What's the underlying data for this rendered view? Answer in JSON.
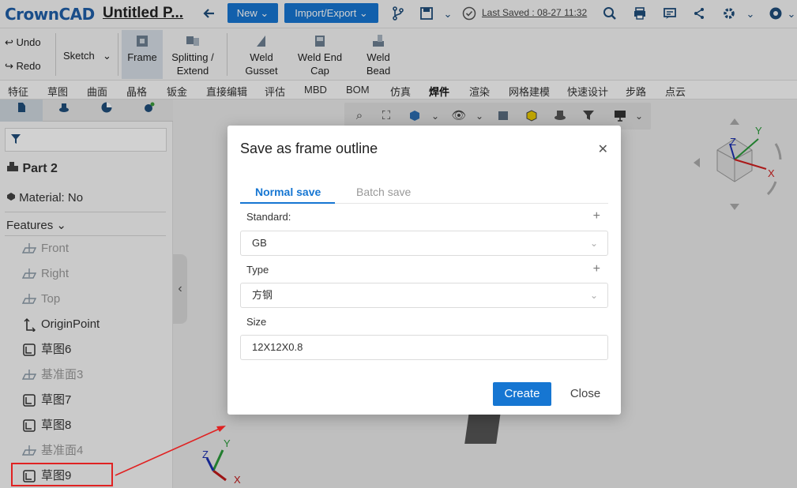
{
  "app": {
    "logo": "CrownCAD",
    "doc_title": "Untitled P..."
  },
  "topbar": {
    "new_label": "New",
    "import_export_label": "Import/Export",
    "last_saved": "Last Saved : 08-27 11:32"
  },
  "ribbon": {
    "undo": "Undo",
    "redo": "Redo",
    "sketch": "Sketch",
    "frame": "Frame",
    "splitting_extend_1": "Splitting /",
    "splitting_extend_2": "Extend",
    "weld_gusset_1": "Weld",
    "weld_gusset_2": "Gusset",
    "weld_end_cap_1": "Weld End",
    "weld_end_cap_2": "Cap",
    "weld_bead_1": "Weld",
    "weld_bead_2": "Bead"
  },
  "tabs": [
    "特征",
    "草图",
    "曲面",
    "晶格",
    "钣金",
    "直接编辑",
    "评估",
    "MBD",
    "BOM",
    "仿真",
    "焊件",
    "渲染",
    "网格建模",
    "快速设计",
    "步路",
    "点云"
  ],
  "active_tab": "焊件",
  "left_panel": {
    "part_title": "Part 2",
    "material": "Material: No",
    "features_label": "Features",
    "features": [
      {
        "label": "Front",
        "dim": true
      },
      {
        "label": "Right",
        "dim": true
      },
      {
        "label": "Top",
        "dim": true
      },
      {
        "label": "OriginPoint",
        "dim": false
      },
      {
        "label": "草图6",
        "dim": false
      },
      {
        "label": "基准面3",
        "dim": true
      },
      {
        "label": "草图7",
        "dim": false
      },
      {
        "label": "草图8",
        "dim": false
      },
      {
        "label": "基准面4",
        "dim": true
      },
      {
        "label": "草图9",
        "dim": false
      }
    ]
  },
  "modal": {
    "title": "Save as frame outline",
    "tab_normal": "Normal save",
    "tab_batch": "Batch save",
    "standard_label": "Standard:",
    "standard_value": "GB",
    "type_label": "Type",
    "type_value": "方钢",
    "size_label": "Size",
    "size_value": "12X12X0.8",
    "create_label": "Create",
    "close_label": "Close"
  },
  "axes": {
    "x": "X",
    "y": "Y",
    "z": "Z"
  },
  "colors": {
    "accent": "#1676d2",
    "highlight": "#e02222"
  }
}
